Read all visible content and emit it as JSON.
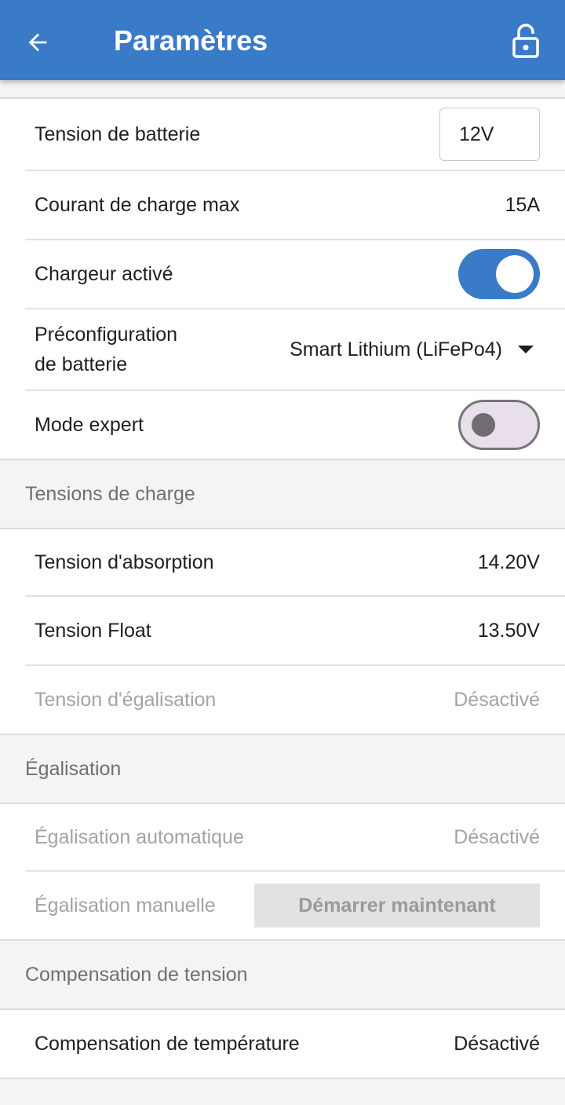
{
  "header": {
    "title": "Paramètres",
    "back_icon": "arrow-left-icon",
    "lock_icon": "unlocked-padlock-icon",
    "color": "#3a7bc8"
  },
  "general": {
    "battery_voltage": {
      "label": "Tension de batterie",
      "value": "12V"
    },
    "max_charge_current": {
      "label": "Courant de charge max",
      "value": "15A"
    },
    "charger_enabled": {
      "label": "Chargeur activé",
      "state": true
    },
    "battery_preset": {
      "label_line1": "Préconfiguration",
      "label_line2": "de batterie",
      "value": "Smart Lithium (LiFePo4)"
    },
    "expert_mode": {
      "label": "Mode expert",
      "state": false
    }
  },
  "charge_voltages": {
    "title": "Tensions de charge",
    "absorption": {
      "label": "Tension d'absorption",
      "value": "14.20V"
    },
    "float": {
      "label": "Tension Float",
      "value": "13.50V"
    },
    "equalization": {
      "label": "Tension d'égalisation",
      "value": "Désactivé"
    }
  },
  "equalization": {
    "title": "Égalisation",
    "automatic": {
      "label": "Égalisation automatique",
      "value": "Désactivé"
    },
    "manual": {
      "label": "Égalisation manuelle",
      "button": "Démarrer maintenant"
    }
  },
  "voltage_compensation": {
    "title": "Compensation de tension",
    "temperature": {
      "label": "Compensation de température",
      "value": "Désactivé"
    }
  }
}
